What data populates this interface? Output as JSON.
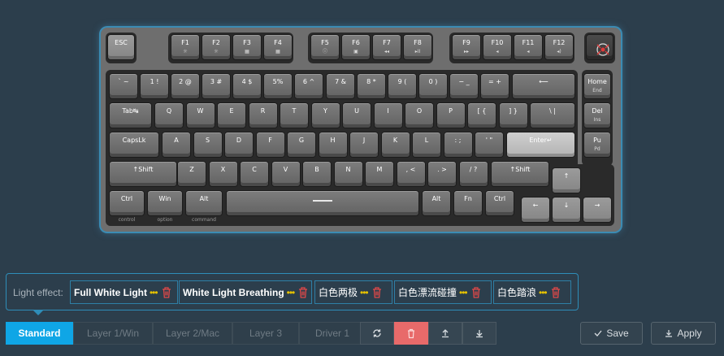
{
  "keyboard": {
    "rows": {
      "fn": [
        "ESC",
        "F1",
        "F2",
        "F3",
        "F4",
        "F5",
        "F6",
        "F7",
        "F8",
        "F9",
        "F10",
        "F11",
        "F12"
      ],
      "fn_sub": [
        "",
        "☼",
        "☼",
        "▦",
        "▦",
        "ⓘ",
        "▣",
        "◂◂",
        "▸II",
        "▸▸",
        "◂",
        "◂",
        "◂)"
      ],
      "num": [
        "` ~",
        "1 !",
        "2 @",
        "3 #",
        "4 $",
        "5%",
        "6 ^",
        "7 &",
        "8 *",
        "9 (",
        "0 )",
        "− _",
        "= +",
        "⟵"
      ],
      "qwerty": [
        "Tab↹",
        "Q",
        "W",
        "E",
        "R",
        "T",
        "Y",
        "U",
        "I",
        "O",
        "P",
        "[ {",
        "] }",
        "\\ |"
      ],
      "home": [
        "CapsLk",
        "A",
        "S",
        "D",
        "F",
        "G",
        "H",
        "J",
        "K",
        "L",
        ": ;",
        "' \"",
        "Enter↵"
      ],
      "shift": [
        "↑Shift",
        "Z",
        "X",
        "C",
        "V",
        "B",
        "N",
        "M",
        ", <",
        ". >",
        "/ ?",
        "↑Shift"
      ],
      "bottom": [
        "Ctrl",
        "Win",
        "Alt",
        "",
        "Alt",
        "Fn",
        "Ctrl"
      ],
      "bottom_below": [
        "control",
        "option",
        "command"
      ],
      "nav": [
        "Home",
        "End",
        "Del",
        "Ins",
        "Pu",
        "Pd"
      ],
      "arrows": [
        "↑",
        "←",
        "↓",
        "→"
      ]
    }
  },
  "light_effect": {
    "label": "Light effect:",
    "items": [
      {
        "name": "Full White Light",
        "dots": "•••"
      },
      {
        "name": "White Light Breathing",
        "dots": "•••"
      },
      {
        "name": "白色两极",
        "dots": "•••"
      },
      {
        "name": "白色漂流碰撞",
        "dots": "•••"
      },
      {
        "name": "白色踏浪",
        "dots": "•••"
      }
    ]
  },
  "layers": [
    "Standard",
    "Layer 1/Win",
    "Layer 2/Mac",
    "Layer 3",
    "Driver 1"
  ],
  "active_layer": "Standard",
  "tools": [
    "refresh-icon",
    "trash-icon",
    "upload-icon",
    "download-icon"
  ],
  "actions": {
    "save": "Save",
    "apply": "Apply"
  },
  "colors": {
    "accent": "#0fa6e6",
    "delete": "#e86a6a",
    "dots": "#e6c200",
    "trash": "#e04848"
  }
}
